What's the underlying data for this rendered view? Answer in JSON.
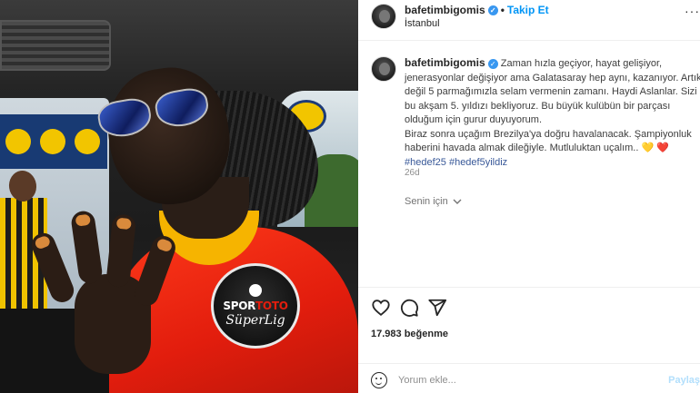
{
  "header": {
    "username": "bafetimbigomis",
    "verified_icon": "verified-badge-icon",
    "separator": "•",
    "follow_label": "Takip Et",
    "location": "İstanbul"
  },
  "caption": {
    "username": "bafetimbigomis",
    "lines": [
      "Zaman hızla geçiyor, hayat gelişiyor,",
      "jenerasyonlar değişiyor ama Galatasaray hep aynı, kazanıyor. Artık",
      "değil 5 parmağımızla selam vermenin zamanı. Haydi Aslanlar. Sizi",
      "bu akşam 5. yıldızı bekliyoruz. Bu büyük kulübün bir parçası",
      "olduğum için gurur duyuyorum.",
      "Biraz sonra uçağım Brezilya'ya doğru havalanacak. Şampiyonluk",
      "haberini havada almak dileğiyle. Mutluluktan uçalım.."
    ],
    "emojis": "💛 ❤️",
    "hashtags": [
      "#hedef25",
      "#hedef5yildiz"
    ],
    "time": "26d",
    "translate_label": "Senin için"
  },
  "patch": {
    "top_a": "SPOR",
    "top_b": "TOTO",
    "bottom": "SüperLig"
  },
  "likes": {
    "text": "17.983 beğenme"
  },
  "comment": {
    "placeholder": "Yorum ekle...",
    "post_label": "Paylaş"
  },
  "colors": {
    "accent": "#0095f6",
    "link": "#385898",
    "jersey": "#e21d0d"
  }
}
